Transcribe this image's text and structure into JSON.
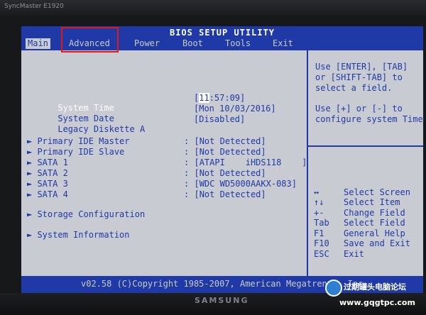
{
  "monitor": {
    "model_label": "SyncMaster E1920",
    "brand": "SAMSUNG"
  },
  "bios": {
    "title": "BIOS SETUP UTILITY",
    "menu": [
      "Main",
      "Advanced",
      "Power",
      "Boot",
      "Tools",
      "Exit"
    ],
    "active_menu": "Main",
    "highlighted_menu": "Advanced"
  },
  "fields": {
    "system_time_label": "System Time",
    "system_time_hour": "11",
    "system_time_rest": ":57:09]",
    "system_time_bracket": "[",
    "system_date_label": "System Date",
    "system_date_value": "[Mon 10/03/2016]",
    "legacy_label": "Legacy Diskette A",
    "legacy_value": "[Disabled]"
  },
  "devices": [
    {
      "label": "Primary IDE Master",
      "sep": ":",
      "value": "[Not Detected]"
    },
    {
      "label": "Primary IDE Slave",
      "sep": ":",
      "value": "[Not Detected]"
    },
    {
      "label": "SATA 1",
      "sep": ":",
      "value": "[ATAPI    iHDS118    ]"
    },
    {
      "label": "SATA 2",
      "sep": ":",
      "value": "[Not Detected]"
    },
    {
      "label": "SATA 3",
      "sep": ":",
      "value": "[WDC WD5000AAKX-083]"
    },
    {
      "label": "SATA 4",
      "sep": ":",
      "value": "[Not Detected]"
    }
  ],
  "submenus": [
    "Storage Configuration",
    "System Information"
  ],
  "help": {
    "block1": [
      "Use [ENTER], [TAB]",
      "or [SHIFT-TAB] to",
      "select a field."
    ],
    "block2": [
      "Use [+] or [-] to",
      "configure system Time"
    ]
  },
  "keys": [
    {
      "key": "↔",
      "action": "Select Screen"
    },
    {
      "key": "↑↓",
      "action": "Select Item"
    },
    {
      "key": "+-",
      "action": "Change Field"
    },
    {
      "key": "Tab",
      "action": "Select Field"
    },
    {
      "key": "F1",
      "action": "General Help"
    },
    {
      "key": "F10",
      "action": "Save and Exit"
    },
    {
      "key": "ESC",
      "action": "Exit"
    }
  ],
  "footer": {
    "copyright": "v02.58 (C)Copyright 1985-2007, American Megatrends, Inc."
  },
  "watermark": {
    "line1": "过期罐头电脑论坛",
    "line2": "www.gqgtpc.com"
  },
  "colors": {
    "bios_blue": "#1f3aa6",
    "bios_gray": "#c9cbd3",
    "highlight_red": "#e01818"
  }
}
